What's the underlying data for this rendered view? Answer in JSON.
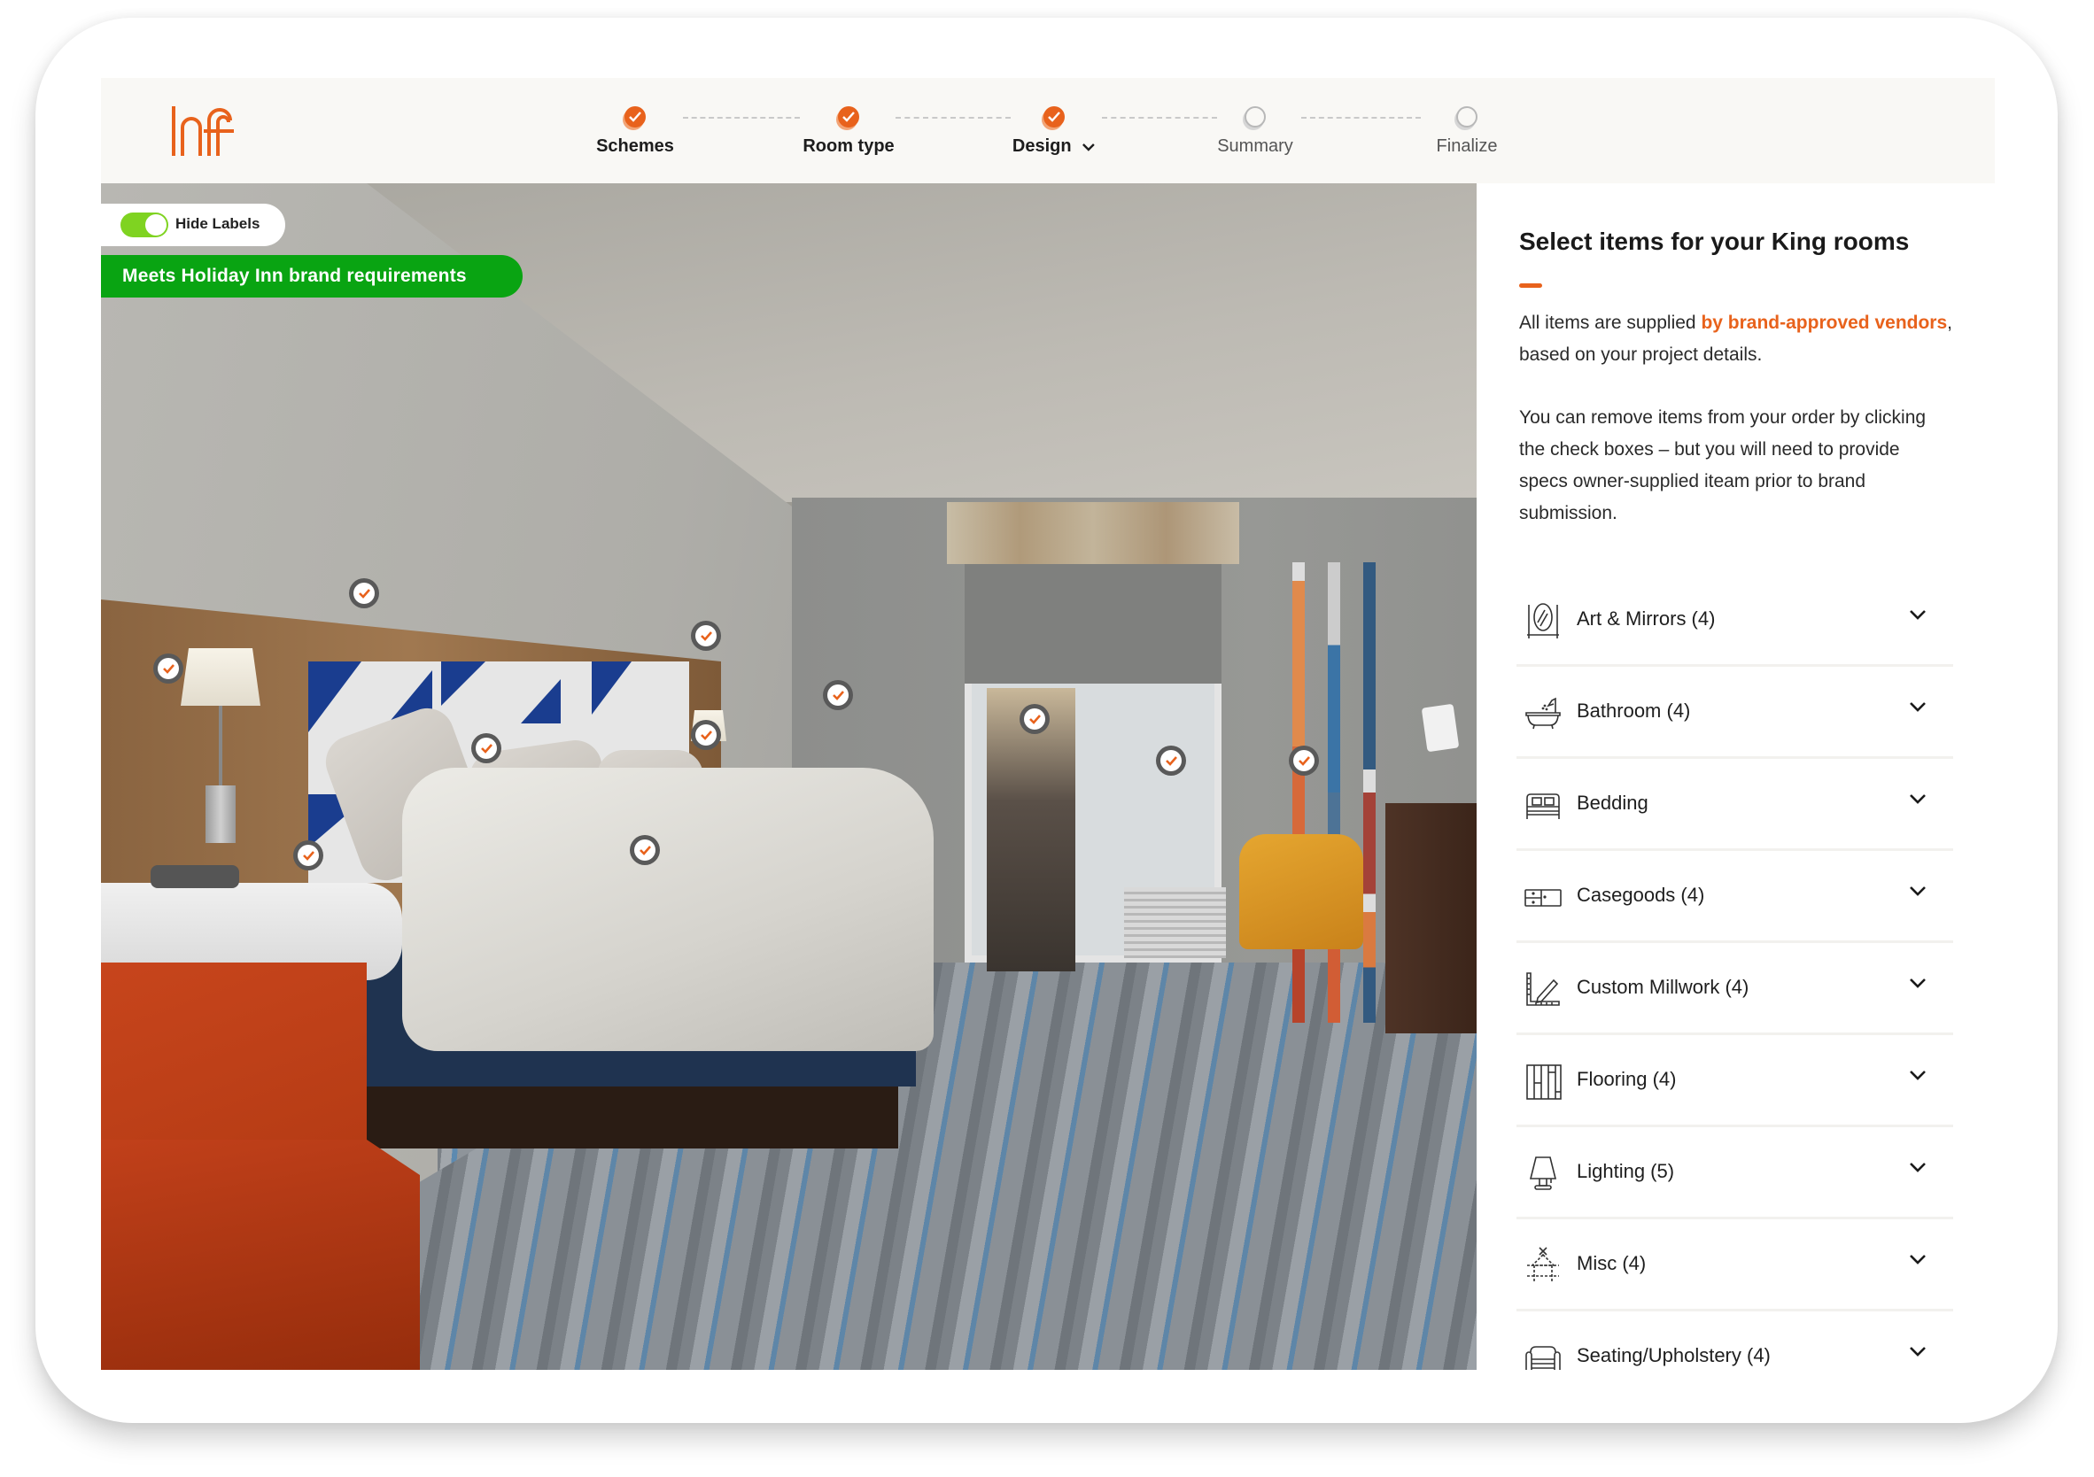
{
  "header": {
    "logo_text": "hf",
    "steps": [
      {
        "label": "Schemes",
        "status": "complete",
        "active": false
      },
      {
        "label": "Room type",
        "status": "complete",
        "active": false
      },
      {
        "label": "Design",
        "status": "complete",
        "active": true,
        "has_dropdown": true
      },
      {
        "label": "Summary",
        "status": "incomplete",
        "active": false
      },
      {
        "label": "Finalize",
        "status": "incomplete",
        "active": false
      }
    ]
  },
  "scene": {
    "toggle": {
      "label": "Hide Labels",
      "on": true
    },
    "brand_badge": "Meets Holiday Inn brand requirements",
    "hotspot_count": 12,
    "hotspot_icon": "check-icon"
  },
  "sidebar": {
    "title": "Select items for your King rooms",
    "intro_prefix": "All items are supplied ",
    "intro_highlight": "by brand-approved vendors",
    "intro_suffix": ", based on your project details.",
    "note": "You can remove items from your order by clicking the check boxes – but you will need to provide specs owner-supplied iteam prior to brand submission.",
    "categories": [
      {
        "label": "Art & Mirrors (4)",
        "icon": "mirror-icon"
      },
      {
        "label": "Bathroom (4)",
        "icon": "bathtub-icon"
      },
      {
        "label": "Bedding",
        "icon": "bed-icon"
      },
      {
        "label": "Casegoods (4)",
        "icon": "dresser-icon"
      },
      {
        "label": "Custom Millwork (4)",
        "icon": "ruler-pencil-icon"
      },
      {
        "label": "Flooring (4)",
        "icon": "flooring-icon"
      },
      {
        "label": "Lighting (5)",
        "icon": "lamp-icon"
      },
      {
        "label": "Misc (4)",
        "icon": "misc-layout-icon"
      },
      {
        "label": "Seating/Upholstery (4)",
        "icon": "armchair-icon"
      }
    ]
  },
  "colors": {
    "accent": "#e8621c",
    "badge_green": "#09a412",
    "toggle_green": "#7fd321",
    "header_bg": "#f9f8f5"
  }
}
